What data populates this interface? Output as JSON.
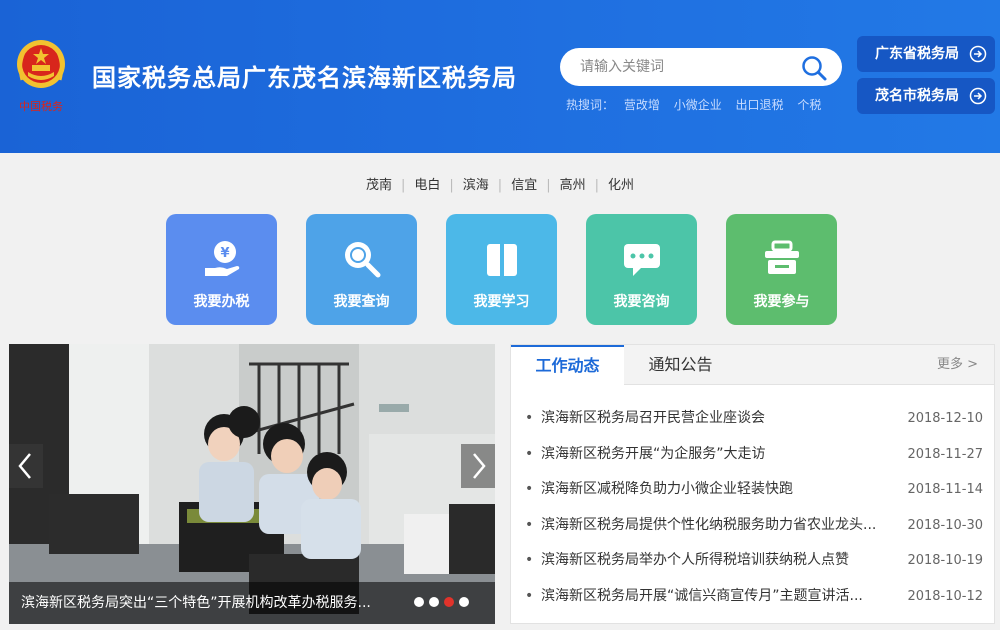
{
  "header": {
    "site_title": "国家税务总局广东茂名滨海新区税务局",
    "emblem_text": "中国税务",
    "search": {
      "placeholder": "请输入关键词"
    },
    "hotwords_label": "热搜词：",
    "hotwords": [
      "营改增",
      "小微企业",
      "出口退税",
      "个税"
    ],
    "links": [
      "广东省税务局",
      "茂名市税务局"
    ]
  },
  "district_nav": [
    "茂南",
    "电白",
    "滨海",
    "信宜",
    "高州",
    "化州"
  ],
  "tiles": [
    {
      "label": "我要办税",
      "color": "#5b8def",
      "icon": "tax-payment-icon"
    },
    {
      "label": "我要查询",
      "color": "#4ea3e8",
      "icon": "search-magnifier-icon"
    },
    {
      "label": "我要学习",
      "color": "#4cb8e8",
      "icon": "book-icon"
    },
    {
      "label": "我要咨询",
      "color": "#4cc5a8",
      "icon": "chat-bubble-icon"
    },
    {
      "label": "我要参与",
      "color": "#5dbd6e",
      "icon": "basket-icon"
    }
  ],
  "banner": {
    "caption": "滨海新区税务局突出“三个特色”开展机构改革办税服务...",
    "slide_count": 4,
    "active_slide": 3
  },
  "news": {
    "tabs": [
      "工作动态",
      "通知公告"
    ],
    "active_tab": 0,
    "more": "更多 >",
    "items": [
      {
        "title": "滨海新区税务局召开民营企业座谈会",
        "date": "2018-12-10"
      },
      {
        "title": "滨海新区税务开展“为企服务”大走访",
        "date": "2018-11-27"
      },
      {
        "title": "滨海新区减税降负助力小微企业轻装快跑",
        "date": "2018-11-14"
      },
      {
        "title": "滨海新区税务局提供个性化纳税服务助力省农业龙头...",
        "date": "2018-10-30"
      },
      {
        "title": "滨海新区税务局举办个人所得税培训获纳税人点赞",
        "date": "2018-10-19"
      },
      {
        "title": "滨海新区税务局开展“诚信兴商宣传月”主题宣讲活...",
        "date": "2018-10-12"
      }
    ]
  }
}
